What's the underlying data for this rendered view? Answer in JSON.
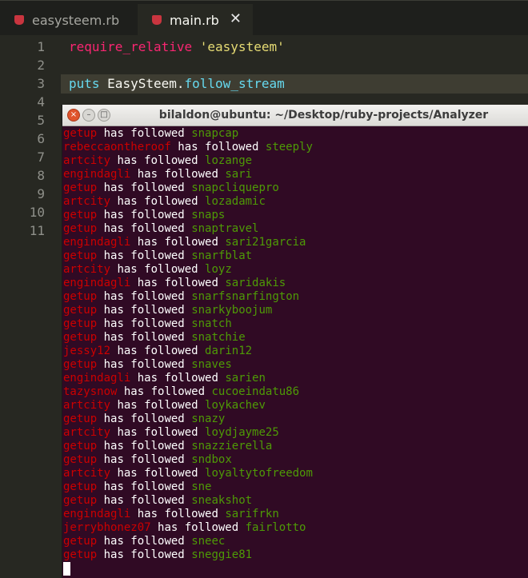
{
  "editor": {
    "tabs": [
      {
        "label": "easysteem.rb",
        "active": false
      },
      {
        "label": "main.rb",
        "active": true
      }
    ],
    "close_glyph": "✕",
    "line_numbers": [
      "1",
      "2",
      "3",
      "4",
      "5",
      "6",
      "7",
      "8",
      "9",
      "10",
      "11"
    ],
    "code": {
      "line1_keyword": "require_relative",
      "line1_string": "'easysteem'",
      "line3_keyword": "puts",
      "line3_class": "EasySteem",
      "line3_dot": ".",
      "line3_method": "follow_stream"
    }
  },
  "terminal": {
    "title": "bilaldon@ubuntu: ~/Desktop/ruby-projects/Analyzer",
    "buttons": {
      "close": "×",
      "min": "–",
      "max": "□"
    },
    "verb": "has followed",
    "lines": [
      {
        "follower": "getup",
        "followee": "snapcap"
      },
      {
        "follower": "rebeccaontheroof",
        "followee": "steeply"
      },
      {
        "follower": "artcity",
        "followee": "lozange"
      },
      {
        "follower": "engindagli",
        "followee": "sari"
      },
      {
        "follower": "getup",
        "followee": "snapcliquepro"
      },
      {
        "follower": "artcity",
        "followee": "lozadamic"
      },
      {
        "follower": "getup",
        "followee": "snaps"
      },
      {
        "follower": "getup",
        "followee": "snaptravel"
      },
      {
        "follower": "engindagli",
        "followee": "sari21garcia"
      },
      {
        "follower": "getup",
        "followee": "snarfblat"
      },
      {
        "follower": "artcity",
        "followee": "loyz"
      },
      {
        "follower": "engindagli",
        "followee": "saridakis"
      },
      {
        "follower": "getup",
        "followee": "snarfsnarfington"
      },
      {
        "follower": "getup",
        "followee": "snarkyboojum"
      },
      {
        "follower": "getup",
        "followee": "snatch"
      },
      {
        "follower": "getup",
        "followee": "snatchie"
      },
      {
        "follower": "jessy12",
        "followee": "darin12"
      },
      {
        "follower": "getup",
        "followee": "snaves"
      },
      {
        "follower": "engindagli",
        "followee": "sarien"
      },
      {
        "follower": "tazysnow",
        "followee": "cucoeindatu86"
      },
      {
        "follower": "artcity",
        "followee": "loykachev"
      },
      {
        "follower": "getup",
        "followee": "snazy"
      },
      {
        "follower": "artcity",
        "followee": "loydjayme25"
      },
      {
        "follower": "getup",
        "followee": "snazzierella"
      },
      {
        "follower": "getup",
        "followee": "sndbox"
      },
      {
        "follower": "artcity",
        "followee": "loyaltytofreedom"
      },
      {
        "follower": "getup",
        "followee": "sne"
      },
      {
        "follower": "getup",
        "followee": "sneakshot"
      },
      {
        "follower": "engindagli",
        "followee": "sarifrkn"
      },
      {
        "follower": "jerrybhonez07",
        "followee": "fairlotto"
      },
      {
        "follower": "getup",
        "followee": "sneec"
      },
      {
        "follower": "getup",
        "followee": "sneggie81"
      }
    ]
  },
  "colors": {
    "editor_bg": "#272822",
    "terminal_bg": "#300a24",
    "follower": "#cc0000",
    "followee": "#4e9a06"
  }
}
